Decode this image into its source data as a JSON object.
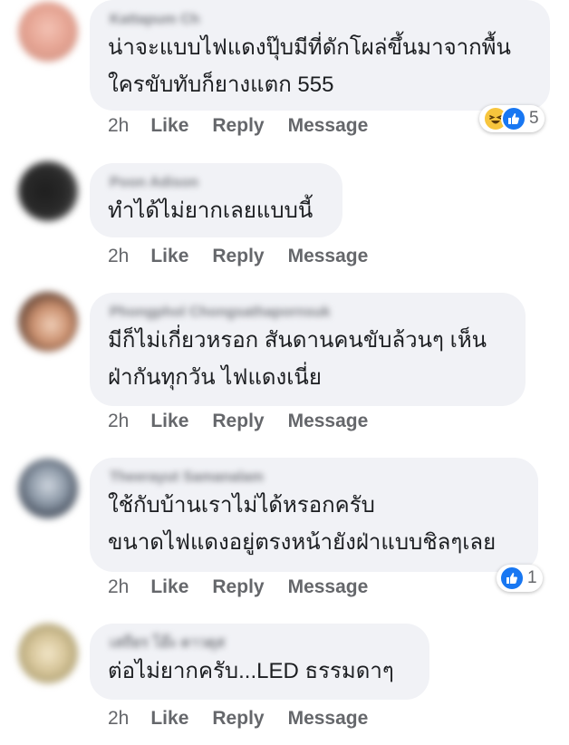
{
  "comments": [
    {
      "author": "Kattapum Ch",
      "lines": [
        "น่าจะแบบไฟแดงปุ๊บมีที่ดักโผล่ขึ้นมาจากพื้น",
        "ใครขับทับก็ยางแตก 555"
      ],
      "time": "2h",
      "reactions": {
        "icons": [
          "haha-icon",
          "like-icon"
        ],
        "count": "5"
      }
    },
    {
      "author": "Poon Adison",
      "lines": [
        "ทำได้ไม่ยากเลยแบบนี้"
      ],
      "time": "2h"
    },
    {
      "author": "Phongphol Chongsathapornsuk",
      "lines": [
        "มีก็ไม่เกี่ยวหรอก สันดานคนขับล้วนๆ เห็น",
        "ฝ่ากันทุกวัน ไฟแดงเนี่ย"
      ],
      "time": "2h"
    },
    {
      "author": "Theerayut Samanalam",
      "lines": [
        "ใช้กับบ้านเราไม่ได้หรอกครับ",
        "ขนาดไฟแดงอยู่ตรงหน้ายังฝ่าแบบชิลๆเลย"
      ],
      "time": "2h",
      "reactions": {
        "icons": [
          "like-icon"
        ],
        "count": "1"
      }
    },
    {
      "author": "เสถียร โอ๊ะ ดาวดุส",
      "lines": [
        "ต่อไม่ยากครับ...LED ธรรมดาๆ"
      ],
      "time": "2h"
    }
  ],
  "actions": {
    "like": "Like",
    "reply": "Reply",
    "message": "Message"
  },
  "colors": {
    "bubble": "#f1f2f6",
    "text": "#1c1e21",
    "meta": "#65676b",
    "like_blue": "#1877f2",
    "haha_yellow": "#f7c53d"
  }
}
